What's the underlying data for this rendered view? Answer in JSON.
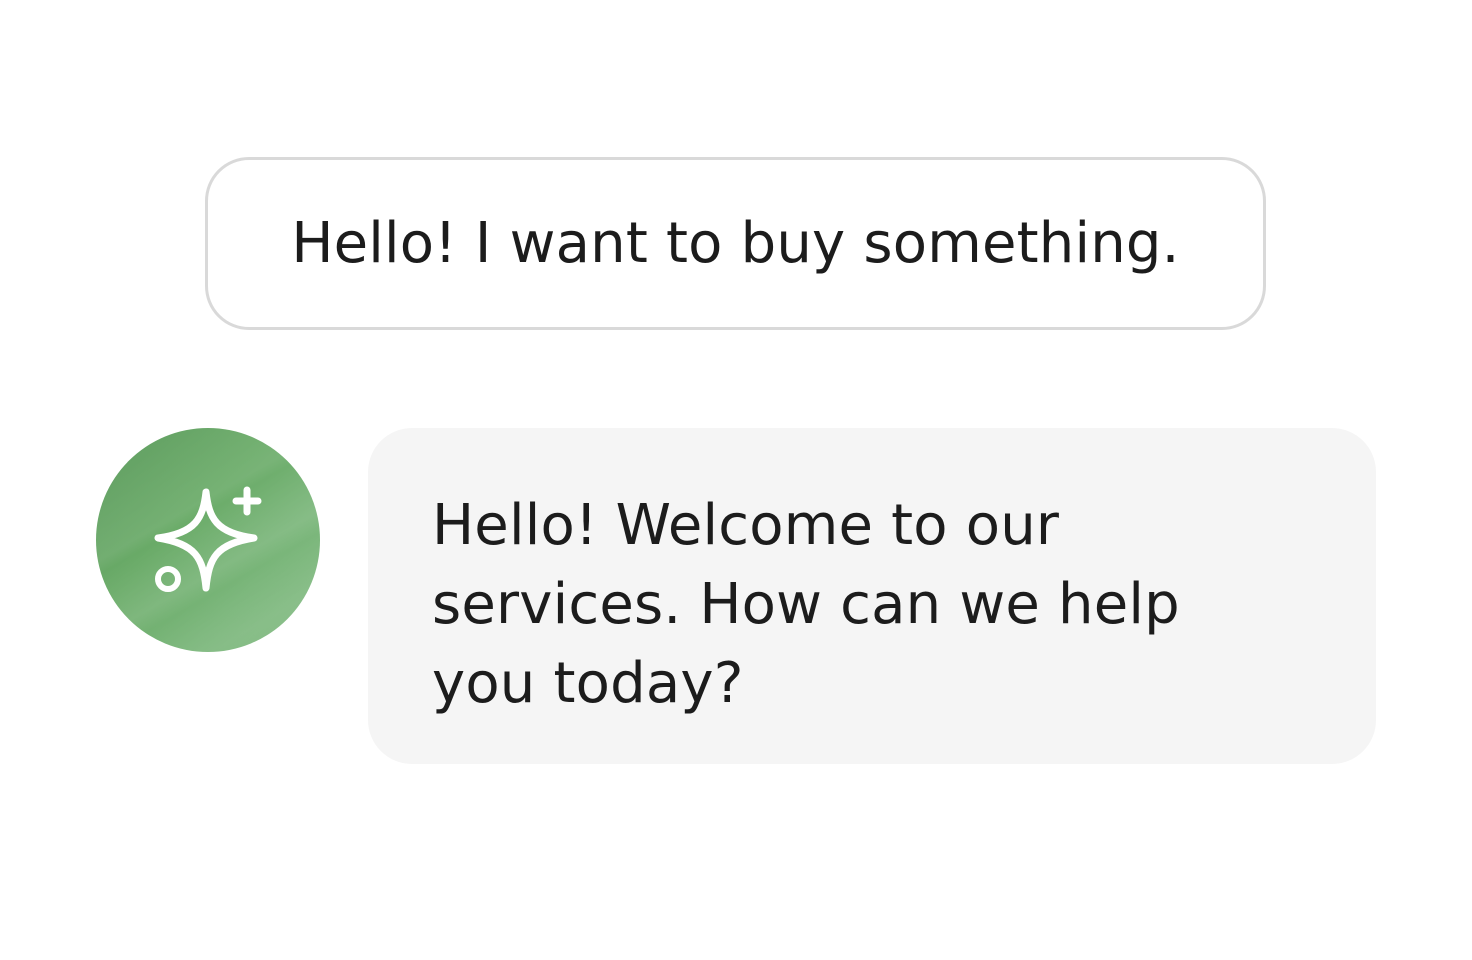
{
  "messages": {
    "user": {
      "text": "Hello! I want to buy something."
    },
    "assistant": {
      "avatar_icon": "sparkles-icon",
      "text": "Hello! Welcome to our\nservices. How can we help\nyou today?"
    }
  },
  "colors": {
    "avatar_green": "#6aab68",
    "assistant_bubble_bg": "#f5f5f5",
    "user_bubble_border": "#d9d9d9",
    "text": "#1c1c1c"
  }
}
